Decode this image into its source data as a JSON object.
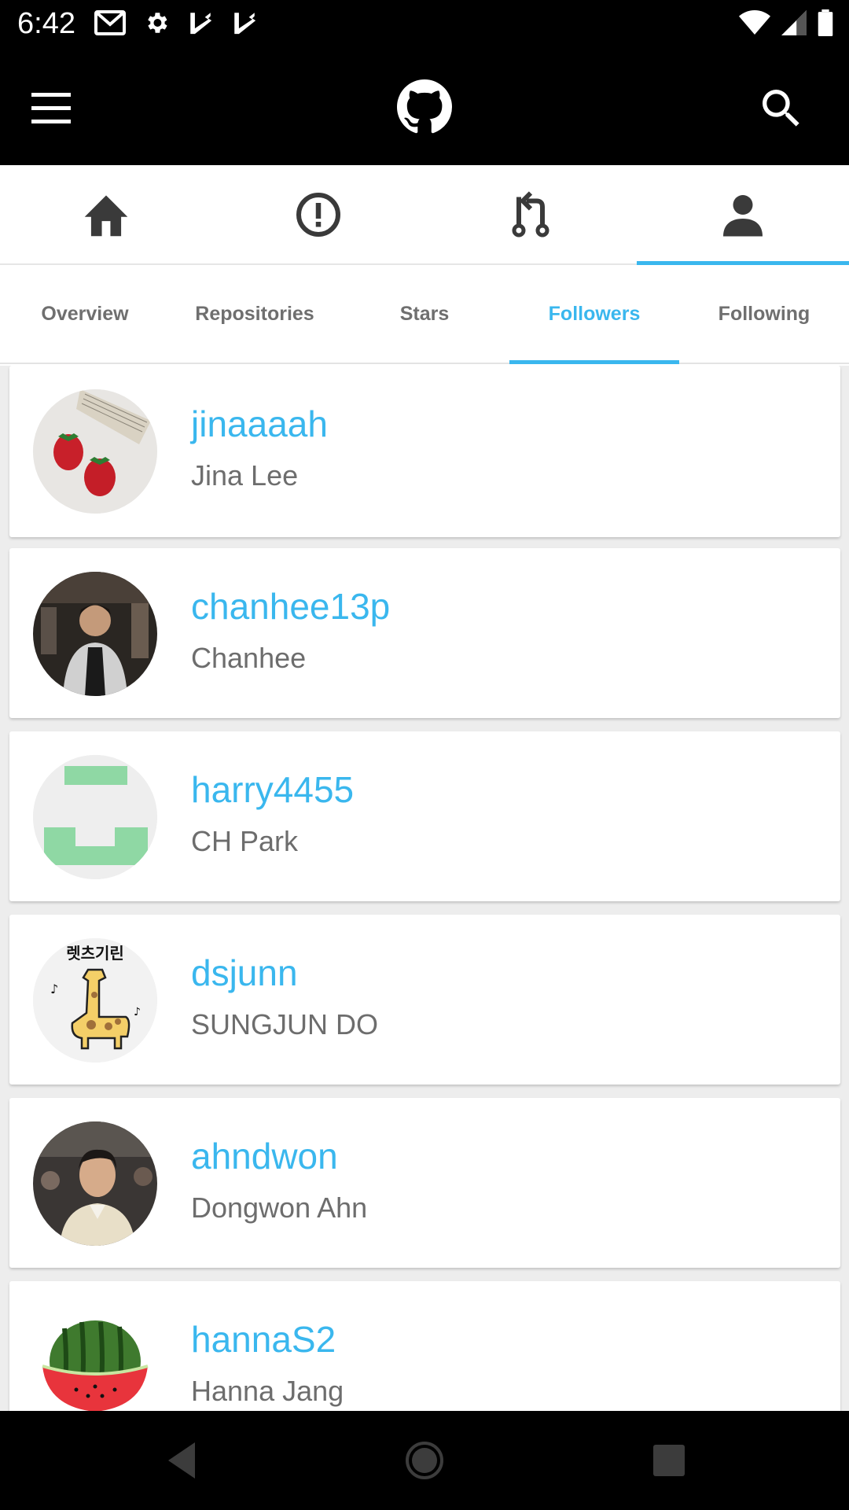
{
  "status_bar": {
    "time": "6:42",
    "left_icons": [
      "gmail-icon",
      "settings-icon",
      "check-flag-icon",
      "check-flag-icon"
    ],
    "right_icons": [
      "wifi-icon",
      "signal-icon",
      "battery-icon"
    ]
  },
  "app_bar": {
    "menu_icon": "hamburger-menu-icon",
    "logo_icon": "github-octocat-icon",
    "search_icon": "search-icon"
  },
  "primary_tabs": [
    {
      "name": "home",
      "icon": "home-icon",
      "active": false
    },
    {
      "name": "issues",
      "icon": "issue-icon",
      "active": false
    },
    {
      "name": "pull-requests",
      "icon": "pull-request-icon",
      "active": false
    },
    {
      "name": "profile",
      "icon": "person-icon",
      "active": true
    }
  ],
  "secondary_tabs": [
    {
      "label": "Overview",
      "active": false
    },
    {
      "label": "Repositories",
      "active": false
    },
    {
      "label": "Stars",
      "active": false
    },
    {
      "label": "Followers",
      "active": true
    },
    {
      "label": "Following",
      "active": false
    }
  ],
  "followers": [
    {
      "login": "jinaaaah",
      "name": "Jina Lee",
      "avatar": "strawberries-photo"
    },
    {
      "login": "chanhee13p",
      "name": "Chanhee",
      "avatar": "person-photo"
    },
    {
      "login": "harry4455",
      "name": "CH Park",
      "avatar": "green-identicon"
    },
    {
      "login": "dsjunn",
      "name": "SUNGJUN DO",
      "avatar": "giraffe-drawing",
      "avatar_text": "렛츠기린"
    },
    {
      "login": "ahndwon",
      "name": "Dongwon Ahn",
      "avatar": "person-photo"
    },
    {
      "login": "hannaS2",
      "name": "Hanna Jang",
      "avatar": "watermelon-photo"
    }
  ],
  "nav_bar": {
    "back_icon": "back-triangle-icon",
    "home_icon": "home-circle-icon",
    "recents_icon": "recents-square-icon"
  },
  "colors": {
    "accent": "#3ab7ee",
    "bar_background": "#000000",
    "secondary_text": "#6d6d6d"
  }
}
